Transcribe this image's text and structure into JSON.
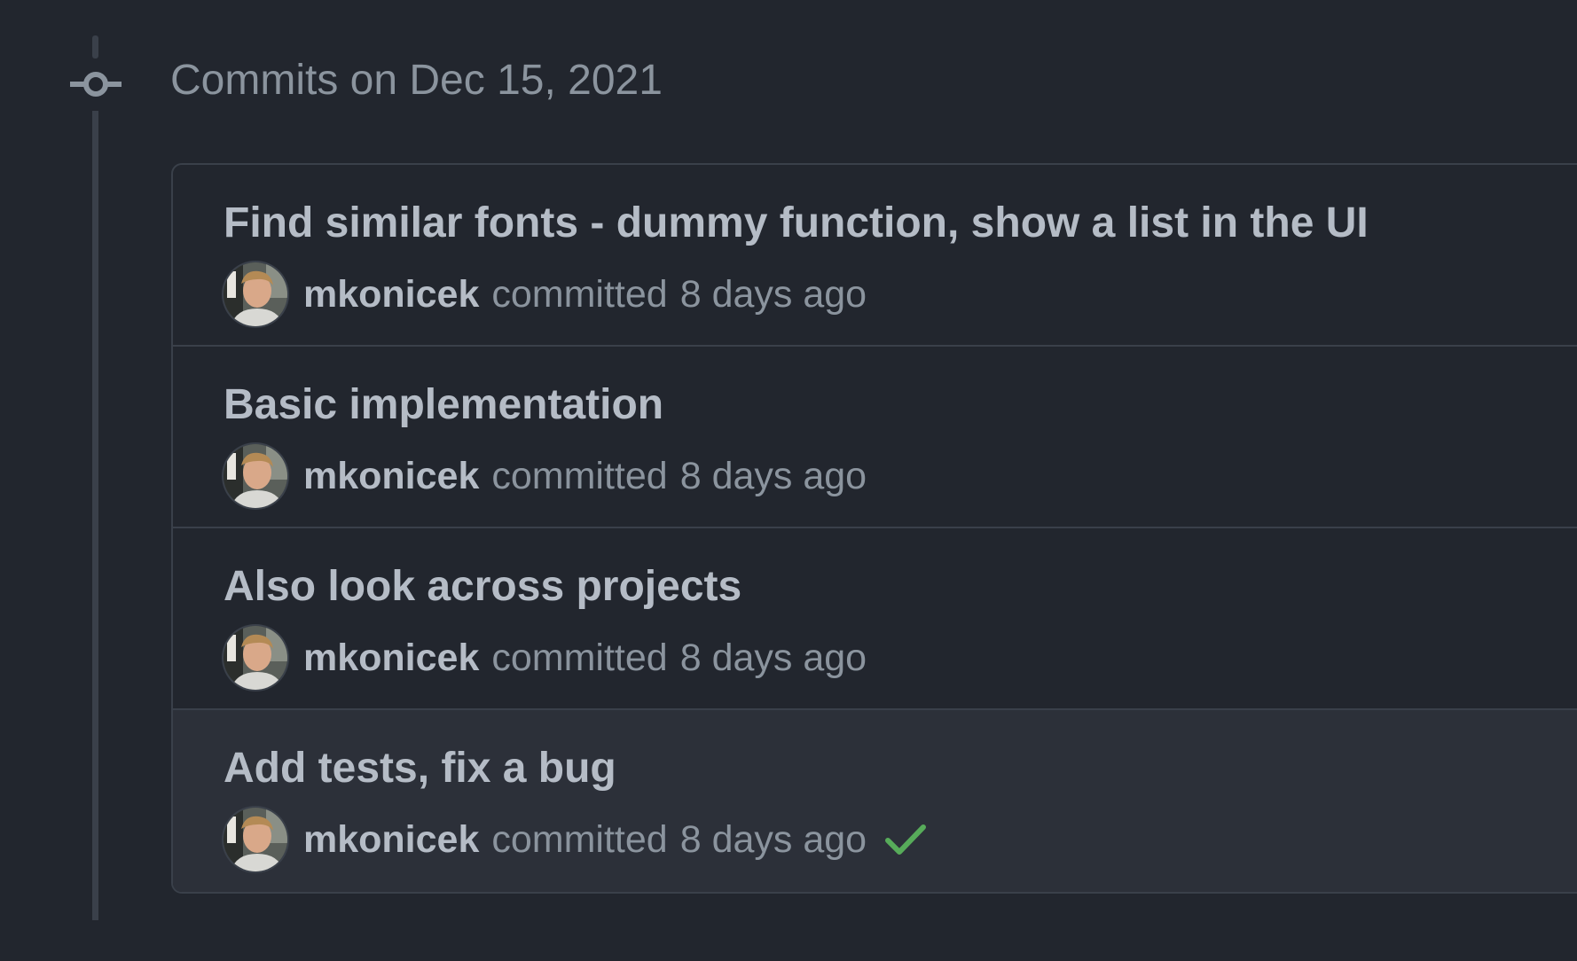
{
  "group": {
    "heading": "Commits on Dec 15, 2021"
  },
  "commits": [
    {
      "title": "Find similar fonts - dummy function, show a list in the UI",
      "author": "mkonicek",
      "action": "committed",
      "time": "8 days ago",
      "status": null
    },
    {
      "title": "Basic implementation",
      "author": "mkonicek",
      "action": "committed",
      "time": "8 days ago",
      "status": null
    },
    {
      "title": "Also look across projects",
      "author": "mkonicek",
      "action": "committed",
      "time": "8 days ago",
      "status": null
    },
    {
      "title": "Add tests, fix a bug",
      "author": "mkonicek",
      "action": "committed",
      "time": "8 days ago",
      "status": "success-check-icon"
    }
  ],
  "colors": {
    "background": "#22262e",
    "border": "#3a404a",
    "hover_row": "#2c3039",
    "text_primary": "#b5bcc6",
    "text_muted": "#8b949e",
    "success": "#57ab5a"
  }
}
